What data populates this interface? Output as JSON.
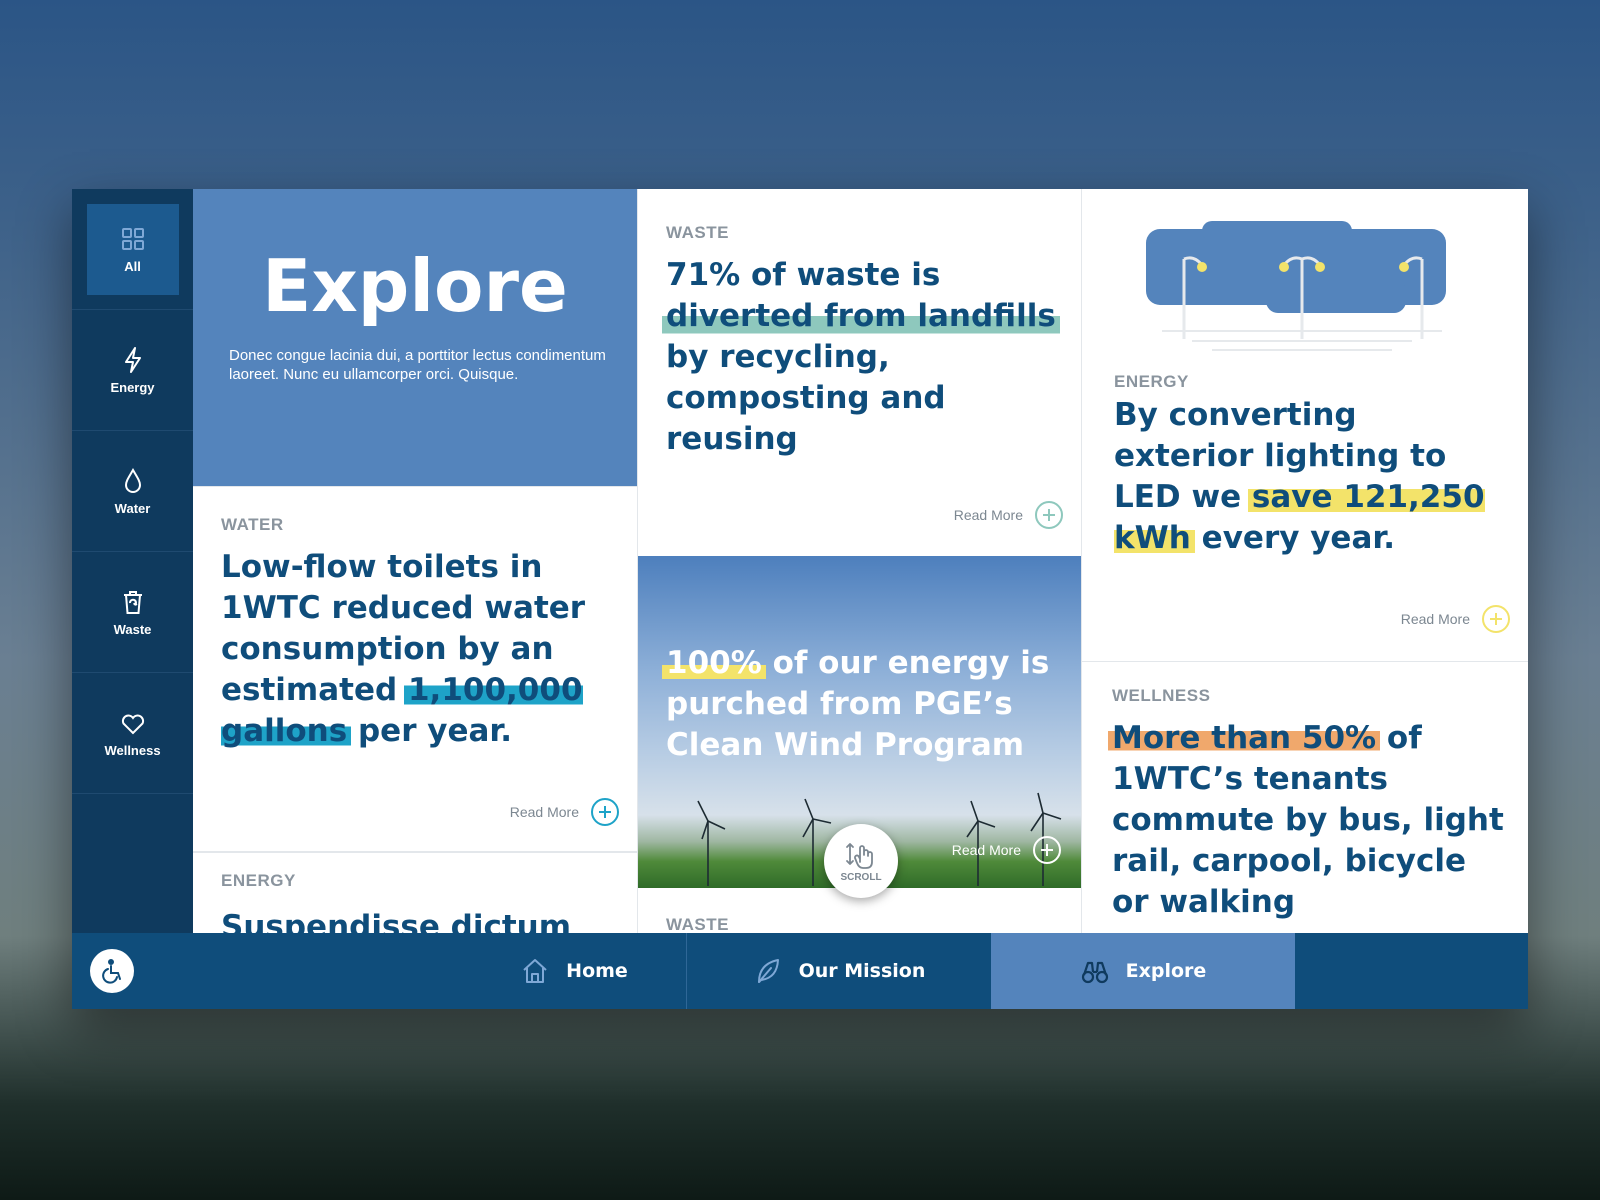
{
  "sidebar": {
    "items": [
      {
        "label": "All",
        "icon": "grid-icon"
      },
      {
        "label": "Energy",
        "icon": "lightning-icon"
      },
      {
        "label": "Water",
        "icon": "droplet-icon"
      },
      {
        "label": "Waste",
        "icon": "recycle-bin-icon"
      },
      {
        "label": "Wellness",
        "icon": "heart-icon"
      }
    ]
  },
  "hero": {
    "title": "Explore",
    "description": "Donec congue lacinia dui, a porttitor lectus condimentum laoreet. Nunc eu ullamcorper orci. Quisque."
  },
  "cards": {
    "water": {
      "category": "WATER",
      "text_before": "Low-flow toilets in 1WTC reduced water consumption by an estimated ",
      "highlight": "1,100,000 gallons",
      "text_after": " per year.",
      "read_more": "Read More",
      "color": "#1ea3c8"
    },
    "waste": {
      "category": "WASTE",
      "text_before": "71% of waste is ",
      "highlight": "diverted from landfills",
      "text_after": " by recycling, composting and reusing",
      "read_more": "Read More",
      "color": "#8ec8bd"
    },
    "energy_led": {
      "category": "ENERGY",
      "text_before": "By converting exterior lighting to LED we ",
      "highlight": "save 121,250 kWh",
      "text_after": " every year.",
      "read_more": "Read More",
      "color": "#f3e36a"
    },
    "wind": {
      "highlight": "100%",
      "text_after": " of our energy is purched from PGE’s Clean Wind Program",
      "read_more": "Read More"
    },
    "wellness": {
      "category": "WELLNESS",
      "highlight": "More than 50%",
      "text_after": " of 1WTC’s tenants commute by bus, light rail, carpool, bicycle or walking",
      "color": "#f0a86c"
    },
    "energy_bottom": {
      "category": "ENERGY",
      "headline_partial": "Suspendisse dictum"
    },
    "waste_bottom": {
      "category": "WASTE"
    }
  },
  "scroll": {
    "label": "SCROLL"
  },
  "bottom_nav": {
    "items": [
      {
        "label": "Home",
        "icon": "home-icon"
      },
      {
        "label": "Our Mission",
        "icon": "leaf-icon"
      },
      {
        "label": "Explore",
        "icon": "binoculars-icon"
      }
    ],
    "active": "Explore"
  },
  "accessibility": {
    "icon": "wheelchair-icon"
  }
}
